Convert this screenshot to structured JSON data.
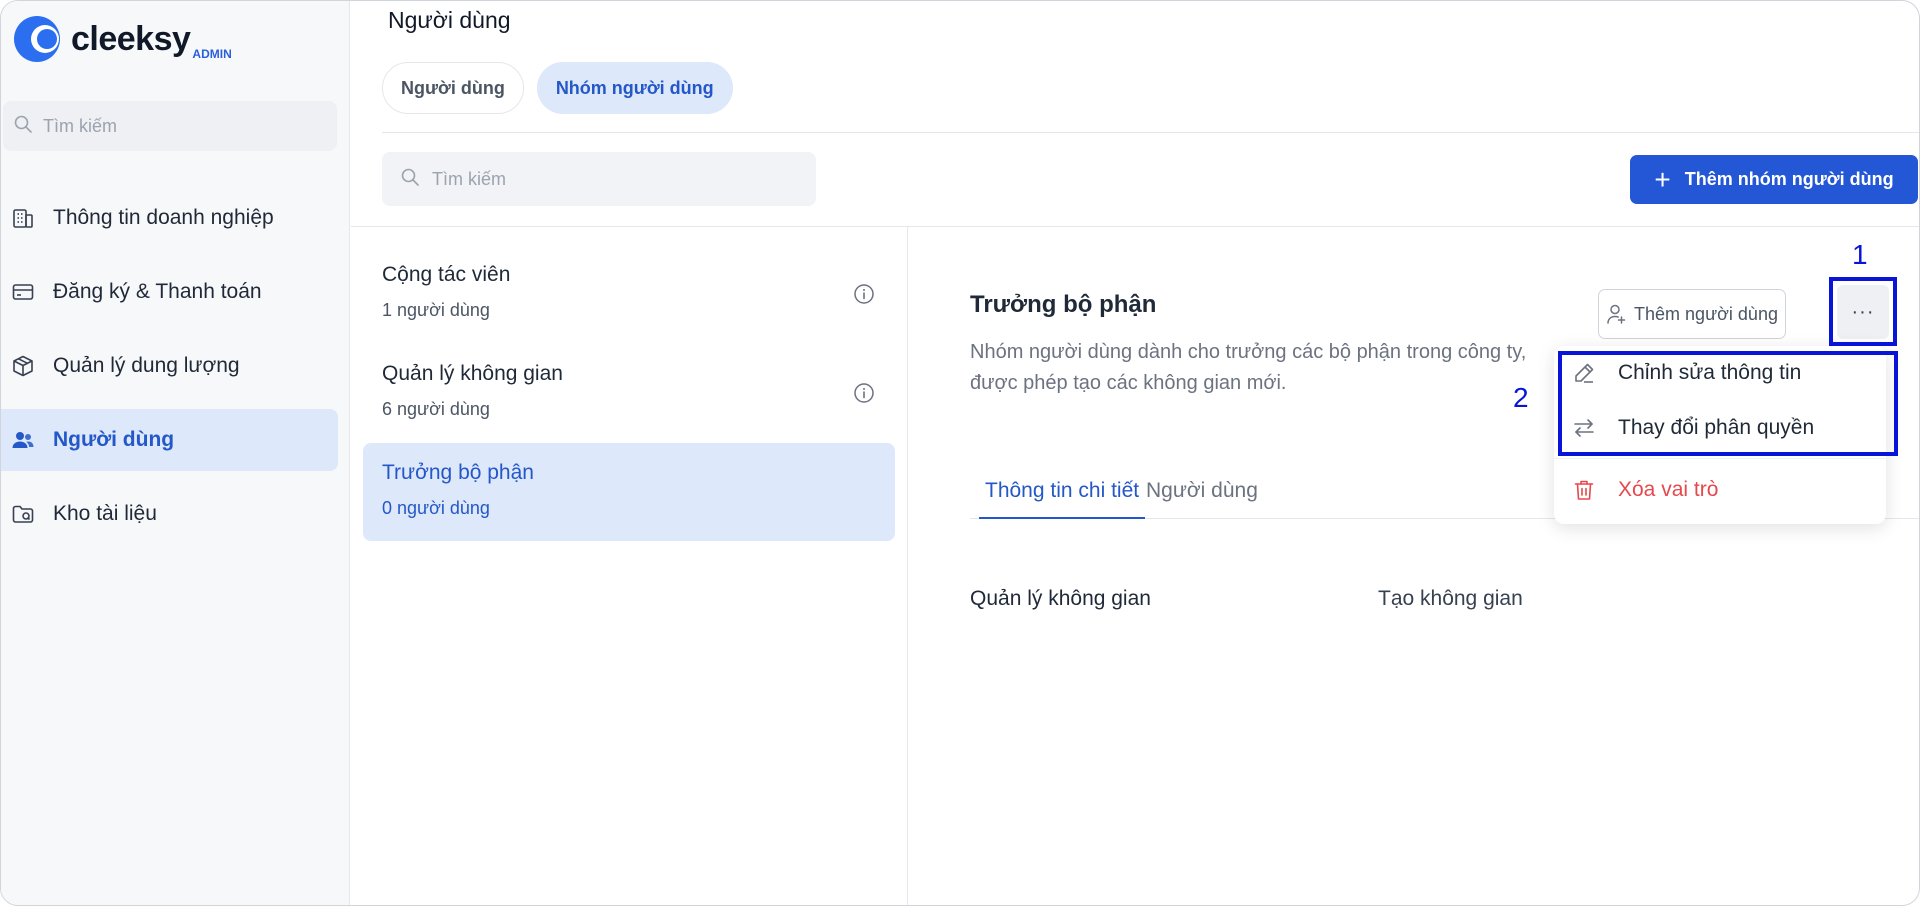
{
  "brand": {
    "name": "cleeksy",
    "badge": "ADMIN",
    "accent": "#2457d6"
  },
  "sidebar": {
    "search_placeholder": "Tìm kiếm",
    "items": [
      {
        "label": "Thông tin doanh nghiệp",
        "icon": "building-icon",
        "active": false
      },
      {
        "label": "Đăng ký & Thanh toán",
        "icon": "credit-card-icon",
        "active": false
      },
      {
        "label": "Quản lý dung lượng",
        "icon": "box-icon",
        "active": false
      },
      {
        "label": "Người dùng",
        "icon": "users-icon",
        "active": true
      },
      {
        "label": "Kho tài liệu",
        "icon": "folder-icon",
        "active": false
      }
    ]
  },
  "main": {
    "title": "Người dùng",
    "pills": [
      {
        "label": "Người dùng",
        "active": false
      },
      {
        "label": "Nhóm người dùng",
        "active": true
      }
    ],
    "search_placeholder": "Tìm kiếm",
    "add_group_label": "Thêm nhóm người dùng",
    "groups": [
      {
        "name": "Cộng tác viên",
        "count": "1 người dùng",
        "active": false
      },
      {
        "name": "Quản lý không gian",
        "count": "6 người dùng",
        "active": false
      },
      {
        "name": "Trưởng bộ phận",
        "count": "0 người dùng",
        "active": true
      }
    ]
  },
  "detail": {
    "title": "Trưởng bộ phận",
    "description": "Nhóm người dùng dành cho trưởng các bộ phận trong công ty, được phép tạo các không gian mới.",
    "add_user_label": "Thêm người dùng",
    "more_label": "···",
    "tabs": [
      {
        "label": "Thông tin chi tiết",
        "active": true
      },
      {
        "label": "Người dùng",
        "active": false
      }
    ],
    "permission_key": "Quản lý không gian",
    "permission_value": "Tạo không gian"
  },
  "menu": {
    "items": [
      {
        "label": "Chỉnh sửa thông tin",
        "icon": "pencil-icon"
      },
      {
        "label": "Thay đổi phân quyền",
        "icon": "swap-icon"
      },
      {
        "label": "Xóa vai trò",
        "icon": "trash-icon",
        "danger": true
      }
    ]
  },
  "annotations": {
    "first": "1",
    "second": "2",
    "color": "#0a14d8"
  }
}
